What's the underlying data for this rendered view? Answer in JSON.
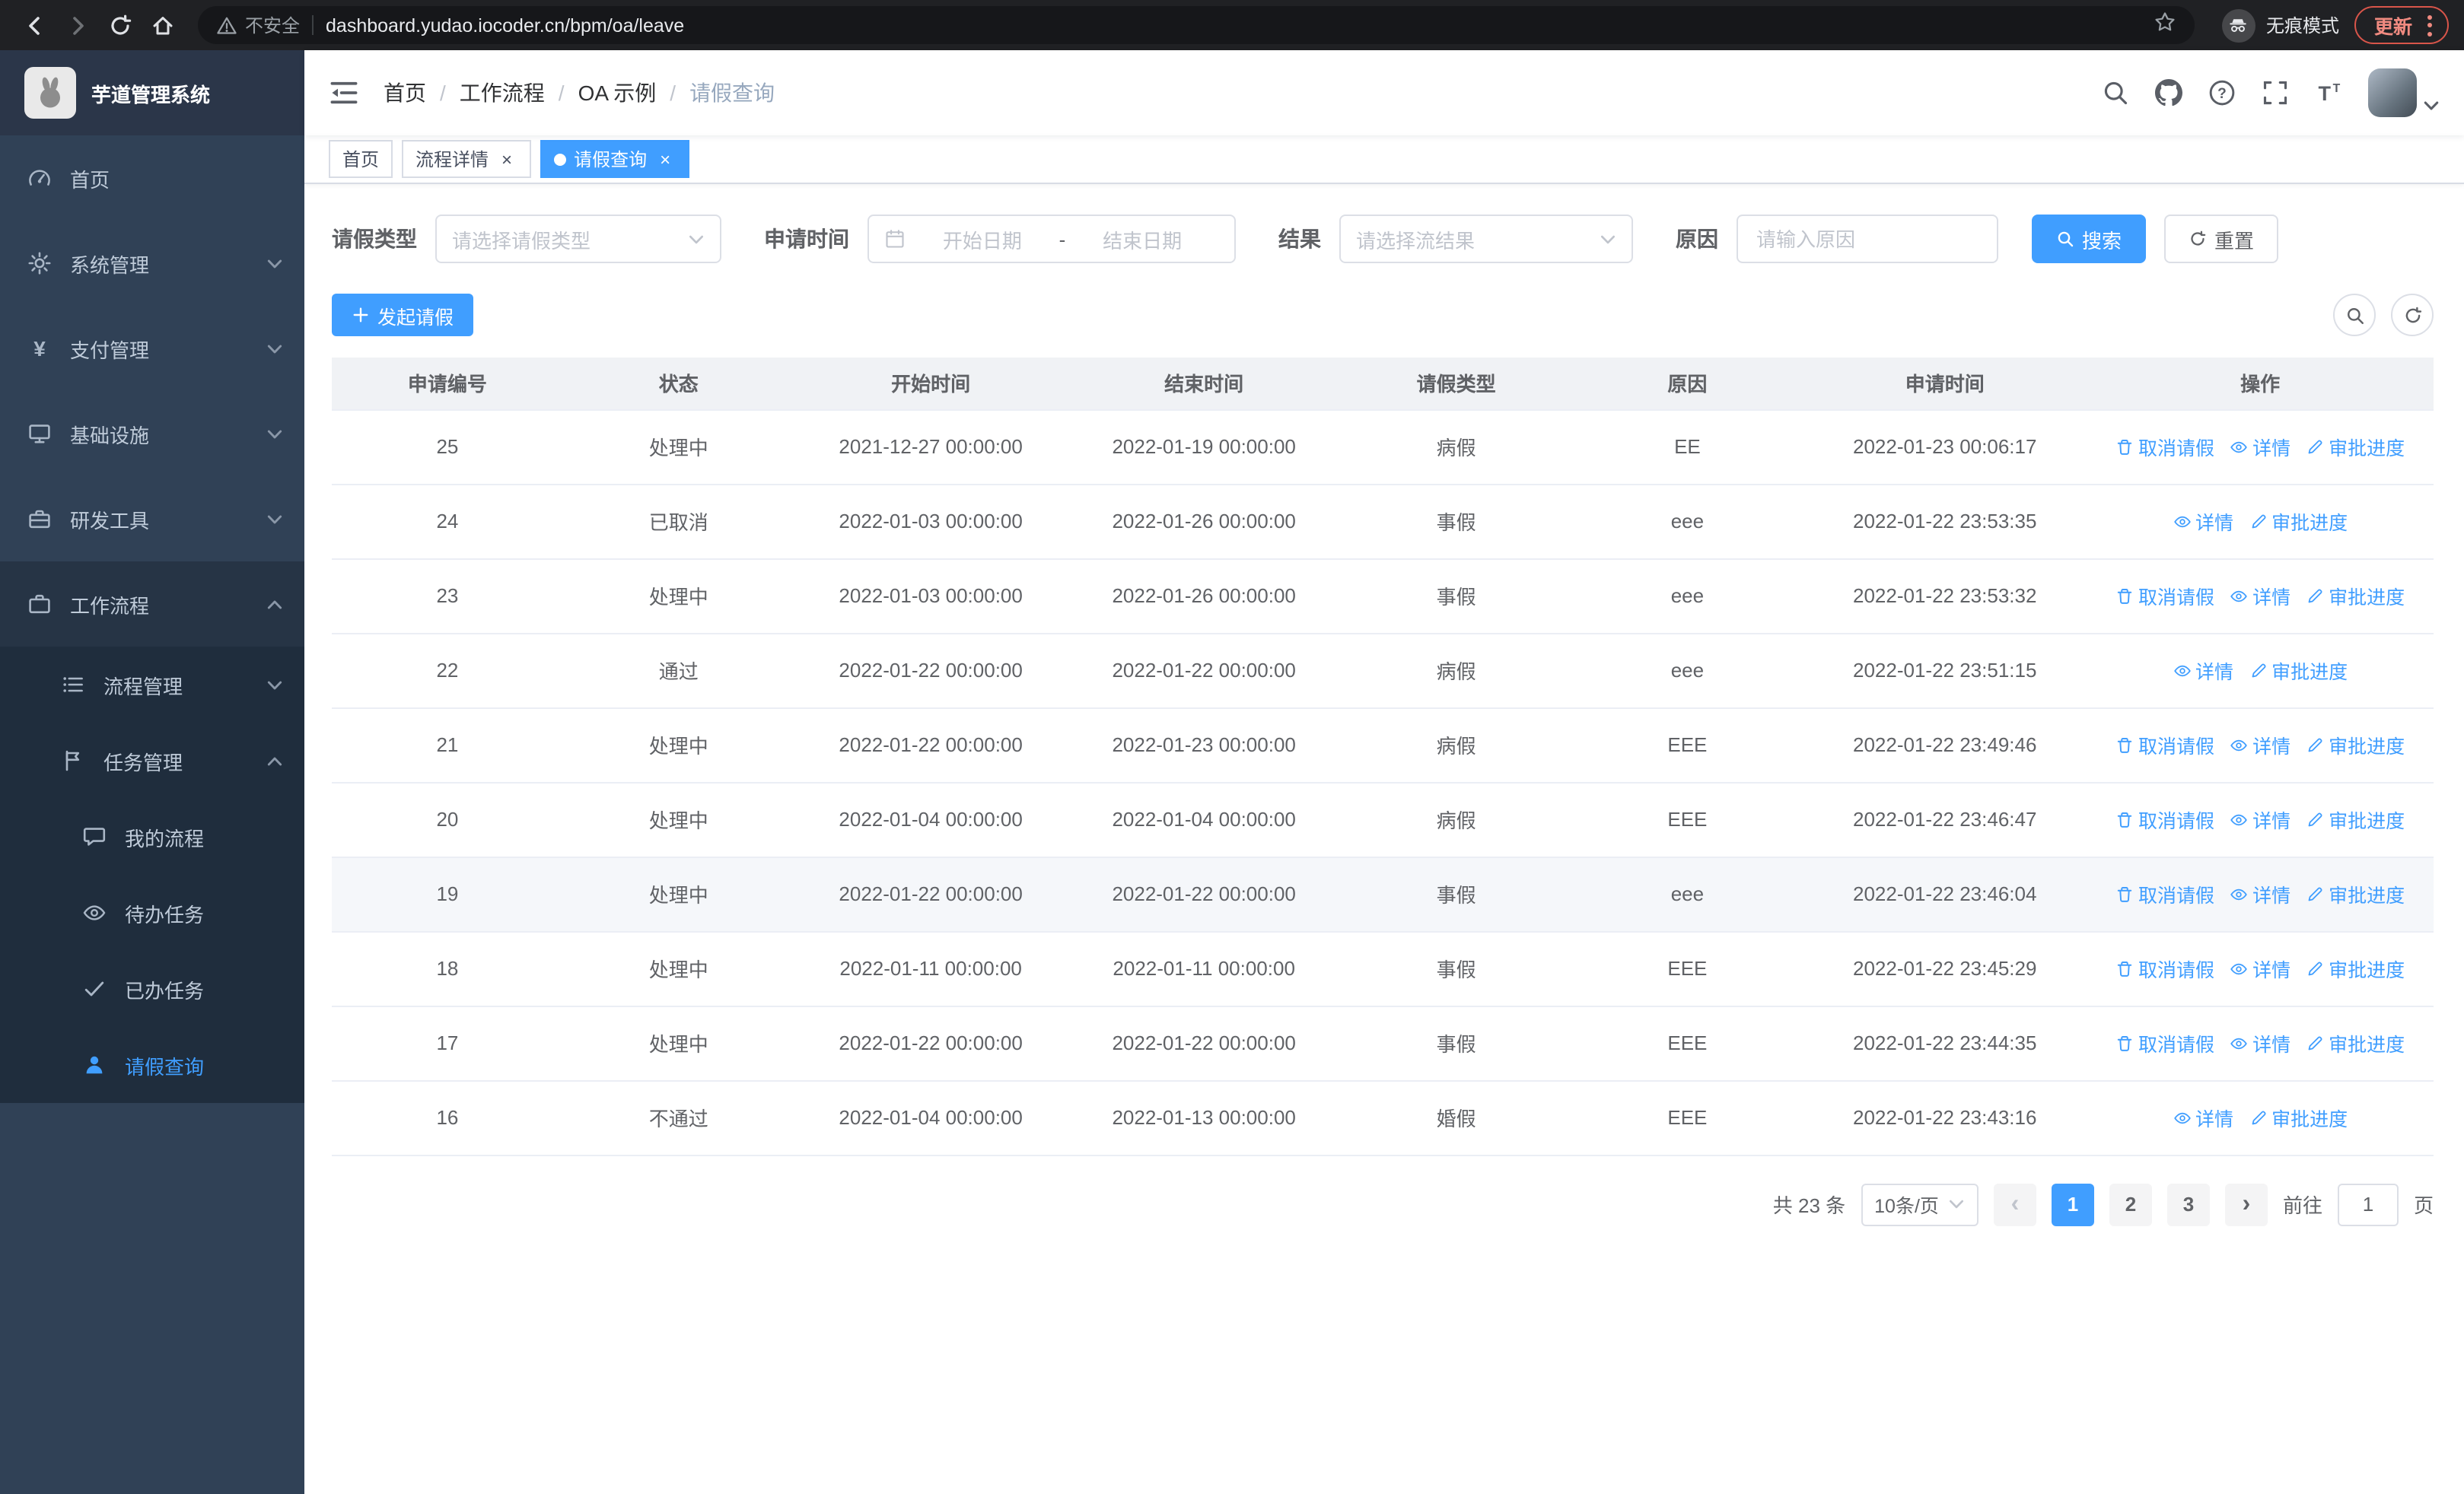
{
  "browser": {
    "security_label": "不安全",
    "url": "dashboard.yudao.iocoder.cn/bpm/oa/leave",
    "incognito_label": "无痕模式",
    "update_label": "更新"
  },
  "sidebar": {
    "title": "芋道管理系统",
    "items": [
      {
        "label": "首页",
        "icon": "dashboard-icon"
      },
      {
        "label": "系统管理",
        "icon": "gear-icon"
      },
      {
        "label": "支付管理",
        "icon": "yen-icon"
      },
      {
        "label": "基础设施",
        "icon": "monitor-icon"
      },
      {
        "label": "研发工具",
        "icon": "toolbox-icon"
      },
      {
        "label": "工作流程",
        "icon": "briefcase-icon"
      }
    ],
    "workflow_children": [
      {
        "label": "流程管理",
        "icon": "list-icon"
      },
      {
        "label": "任务管理",
        "icon": "flag-icon"
      }
    ],
    "task_children": [
      {
        "label": "我的流程",
        "icon": "chat-icon"
      },
      {
        "label": "待办任务",
        "icon": "eye-icon"
      },
      {
        "label": "已办任务",
        "icon": "check-icon"
      },
      {
        "label": "请假查询",
        "icon": "user-icon"
      }
    ]
  },
  "header": {
    "breadcrumb": [
      "首页",
      "工作流程",
      "OA 示例",
      "请假查询"
    ]
  },
  "tabs": [
    {
      "label": "首页"
    },
    {
      "label": "流程详情"
    },
    {
      "label": "请假查询"
    }
  ],
  "filters": {
    "leave_type_label": "请假类型",
    "leave_type_placeholder": "请选择请假类型",
    "apply_time_label": "申请时间",
    "start_date_placeholder": "开始日期",
    "range_separator": "-",
    "end_date_placeholder": "结束日期",
    "result_label": "结果",
    "result_placeholder": "请选择流结果",
    "reason_label": "原因",
    "reason_placeholder": "请输入原因",
    "search_label": "搜索",
    "reset_label": "重置"
  },
  "toolbar": {
    "create_label": "发起请假"
  },
  "table": {
    "columns": [
      "申请编号",
      "状态",
      "开始时间",
      "结束时间",
      "请假类型",
      "原因",
      "申请时间",
      "操作"
    ],
    "action_labels": {
      "cancel": "取消请假",
      "detail": "详情",
      "progress": "审批进度"
    },
    "rows": [
      {
        "no": "25",
        "status": "处理中",
        "start": "2021-12-27 00:00:00",
        "end": "2022-01-19 00:00:00",
        "type": "病假",
        "reason": "EE",
        "applied": "2022-01-23 00:06:17",
        "actions": [
          "cancel",
          "detail",
          "progress"
        ]
      },
      {
        "no": "24",
        "status": "已取消",
        "start": "2022-01-03 00:00:00",
        "end": "2022-01-26 00:00:00",
        "type": "事假",
        "reason": "eee",
        "applied": "2022-01-22 23:53:35",
        "actions": [
          "detail",
          "progress"
        ]
      },
      {
        "no": "23",
        "status": "处理中",
        "start": "2022-01-03 00:00:00",
        "end": "2022-01-26 00:00:00",
        "type": "事假",
        "reason": "eee",
        "applied": "2022-01-22 23:53:32",
        "actions": [
          "cancel",
          "detail",
          "progress"
        ]
      },
      {
        "no": "22",
        "status": "通过",
        "start": "2022-01-22 00:00:00",
        "end": "2022-01-22 00:00:00",
        "type": "病假",
        "reason": "eee",
        "applied": "2022-01-22 23:51:15",
        "actions": [
          "detail",
          "progress"
        ]
      },
      {
        "no": "21",
        "status": "处理中",
        "start": "2022-01-22 00:00:00",
        "end": "2022-01-23 00:00:00",
        "type": "病假",
        "reason": "EEE",
        "applied": "2022-01-22 23:49:46",
        "actions": [
          "cancel",
          "detail",
          "progress"
        ]
      },
      {
        "no": "20",
        "status": "处理中",
        "start": "2022-01-04 00:00:00",
        "end": "2022-01-04 00:00:00",
        "type": "病假",
        "reason": "EEE",
        "applied": "2022-01-22 23:46:47",
        "actions": [
          "cancel",
          "detail",
          "progress"
        ]
      },
      {
        "no": "19",
        "status": "处理中",
        "start": "2022-01-22 00:00:00",
        "end": "2022-01-22 00:00:00",
        "type": "事假",
        "reason": "eee",
        "applied": "2022-01-22 23:46:04",
        "actions": [
          "cancel",
          "detail",
          "progress"
        ],
        "highlighted": true
      },
      {
        "no": "18",
        "status": "处理中",
        "start": "2022-01-11 00:00:00",
        "end": "2022-01-11 00:00:00",
        "type": "事假",
        "reason": "EEE",
        "applied": "2022-01-22 23:45:29",
        "actions": [
          "cancel",
          "detail",
          "progress"
        ]
      },
      {
        "no": "17",
        "status": "处理中",
        "start": "2022-01-22 00:00:00",
        "end": "2022-01-22 00:00:00",
        "type": "事假",
        "reason": "EEE",
        "applied": "2022-01-22 23:44:35",
        "actions": [
          "cancel",
          "detail",
          "progress"
        ]
      },
      {
        "no": "16",
        "status": "不通过",
        "start": "2022-01-04 00:00:00",
        "end": "2022-01-13 00:00:00",
        "type": "婚假",
        "reason": "EEE",
        "applied": "2022-01-22 23:43:16",
        "actions": [
          "detail",
          "progress"
        ]
      }
    ]
  },
  "pagination": {
    "total": "共 23 条",
    "page_size": "10条/页",
    "pages": [
      "1",
      "2",
      "3"
    ],
    "active_page": "1",
    "goto_prefix": "前往",
    "goto_value": "1",
    "goto_suffix": "页"
  },
  "colors": {
    "primary": "#409eff",
    "sidebar_bg": "#304156",
    "submenu_bg": "#1f2d3d"
  }
}
